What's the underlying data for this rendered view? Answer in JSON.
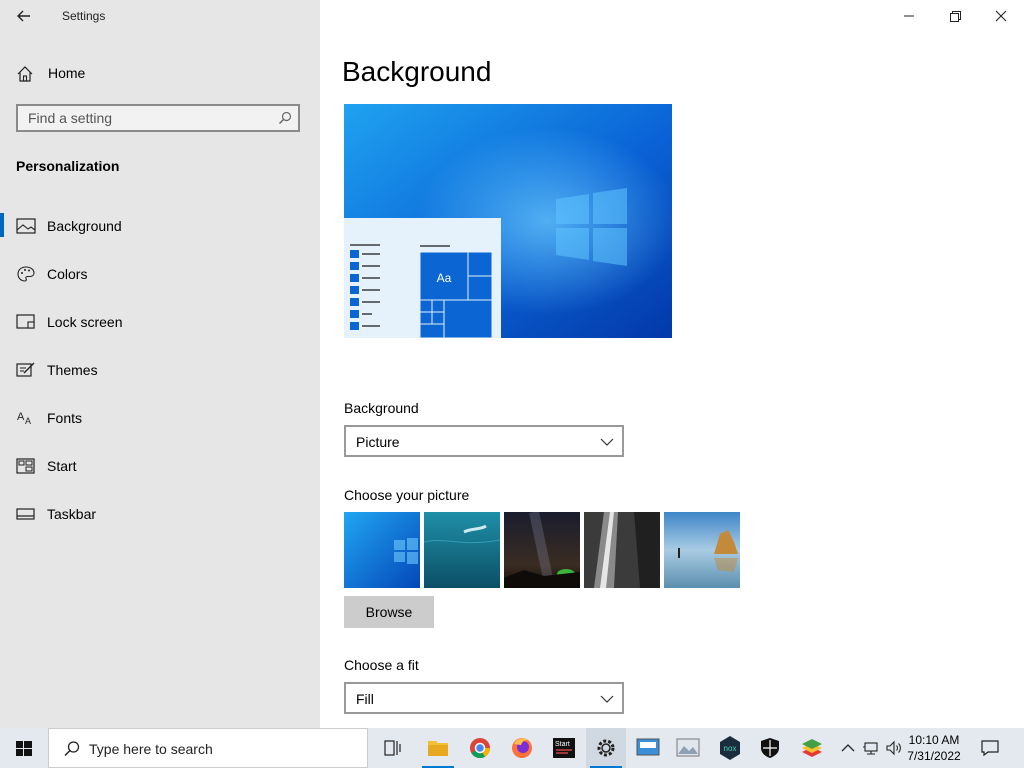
{
  "window": {
    "title": "Settings"
  },
  "sidebar": {
    "home_label": "Home",
    "search_placeholder": "Find a setting",
    "section": "Personalization",
    "items": [
      {
        "label": "Background",
        "icon": "picture-icon",
        "active": true
      },
      {
        "label": "Colors",
        "icon": "palette-icon"
      },
      {
        "label": "Lock screen",
        "icon": "lock-screen-icon"
      },
      {
        "label": "Themes",
        "icon": "themes-icon"
      },
      {
        "label": "Fonts",
        "icon": "fonts-icon"
      },
      {
        "label": "Start",
        "icon": "start-icon"
      },
      {
        "label": "Taskbar",
        "icon": "taskbar-icon"
      }
    ]
  },
  "main": {
    "title": "Background",
    "preview": {
      "tile_label": "Aa"
    },
    "background_label": "Background",
    "background_value": "Picture",
    "choose_picture_label": "Choose your picture",
    "browse_label": "Browse",
    "fit_label": "Choose a fit",
    "fit_value": "Fill"
  },
  "taskbar": {
    "search_placeholder": "Type here to search",
    "time": "10:10 AM",
    "date": "7/31/2022",
    "start_tile_label": "Start",
    "nox_label": "nox"
  },
  "colors": {
    "accent": "#0067c0",
    "sidebar_bg": "#e6e6e6",
    "taskbar_bg": "#e4e9ef"
  }
}
